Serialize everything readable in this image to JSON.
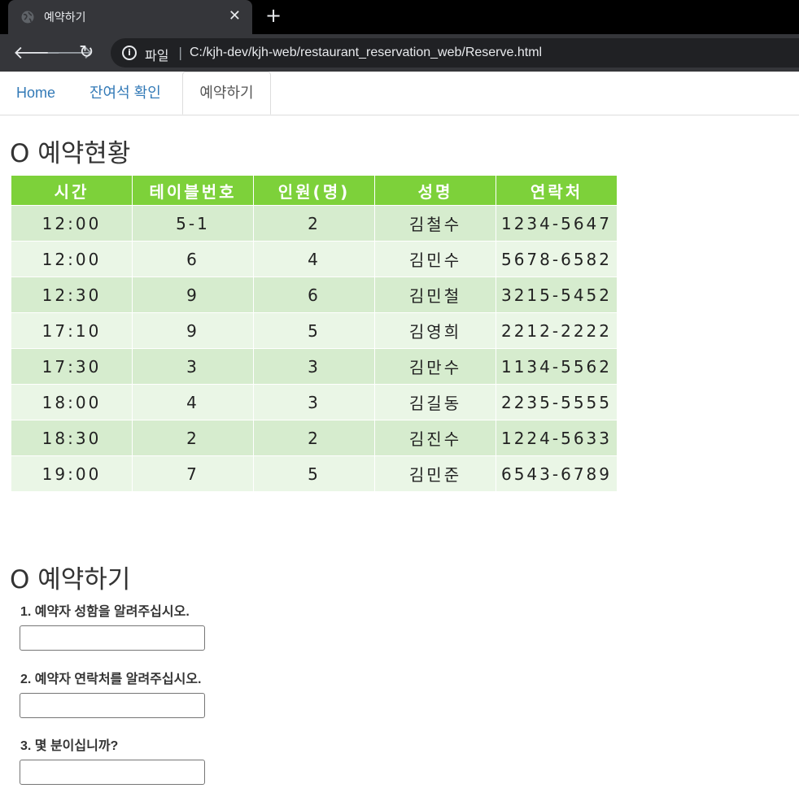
{
  "browser": {
    "tab_title": "예약하기",
    "scheme_label": "파일",
    "url": "C:/kjh-dev/kjh-web/restaurant_reservation_web/Reserve.html"
  },
  "nav": {
    "items": [
      "Home",
      "잔여석 확인",
      "예약하기"
    ],
    "active_index": 2
  },
  "status_section": {
    "heading": "O 예약현황",
    "columns": [
      "시간",
      "테이블번호",
      "인원(명)",
      "성명",
      "연락처"
    ],
    "rows": [
      [
        "12:00",
        "5-1",
        "2",
        "김철수",
        "1234-5647"
      ],
      [
        "12:00",
        "6",
        "4",
        "김민수",
        "5678-6582"
      ],
      [
        "12:30",
        "9",
        "6",
        "김민철",
        "3215-5452"
      ],
      [
        "17:10",
        "9",
        "5",
        "김영희",
        "2212-2222"
      ],
      [
        "17:30",
        "3",
        "3",
        "김만수",
        "1134-5562"
      ],
      [
        "18:00",
        "4",
        "3",
        "김길동",
        "2235-5555"
      ],
      [
        "18:30",
        "2",
        "2",
        "김진수",
        "1224-5633"
      ],
      [
        "19:00",
        "7",
        "5",
        "김민준",
        "6543-6789"
      ]
    ]
  },
  "reserve_section": {
    "heading": "O 예약하기",
    "questions": [
      {
        "label": "1. 예약자 성함을 알려주십시오.",
        "value": ""
      },
      {
        "label": "2. 예약자 연락처를 알려주십시오.",
        "value": ""
      },
      {
        "label": "3. 몇 분이십니까?",
        "value": ""
      }
    ]
  },
  "colors": {
    "header_green": "#7dd13a",
    "row_dark": "#d6ecce",
    "row_light": "#eaf6e6",
    "link_blue": "#337ab7"
  }
}
